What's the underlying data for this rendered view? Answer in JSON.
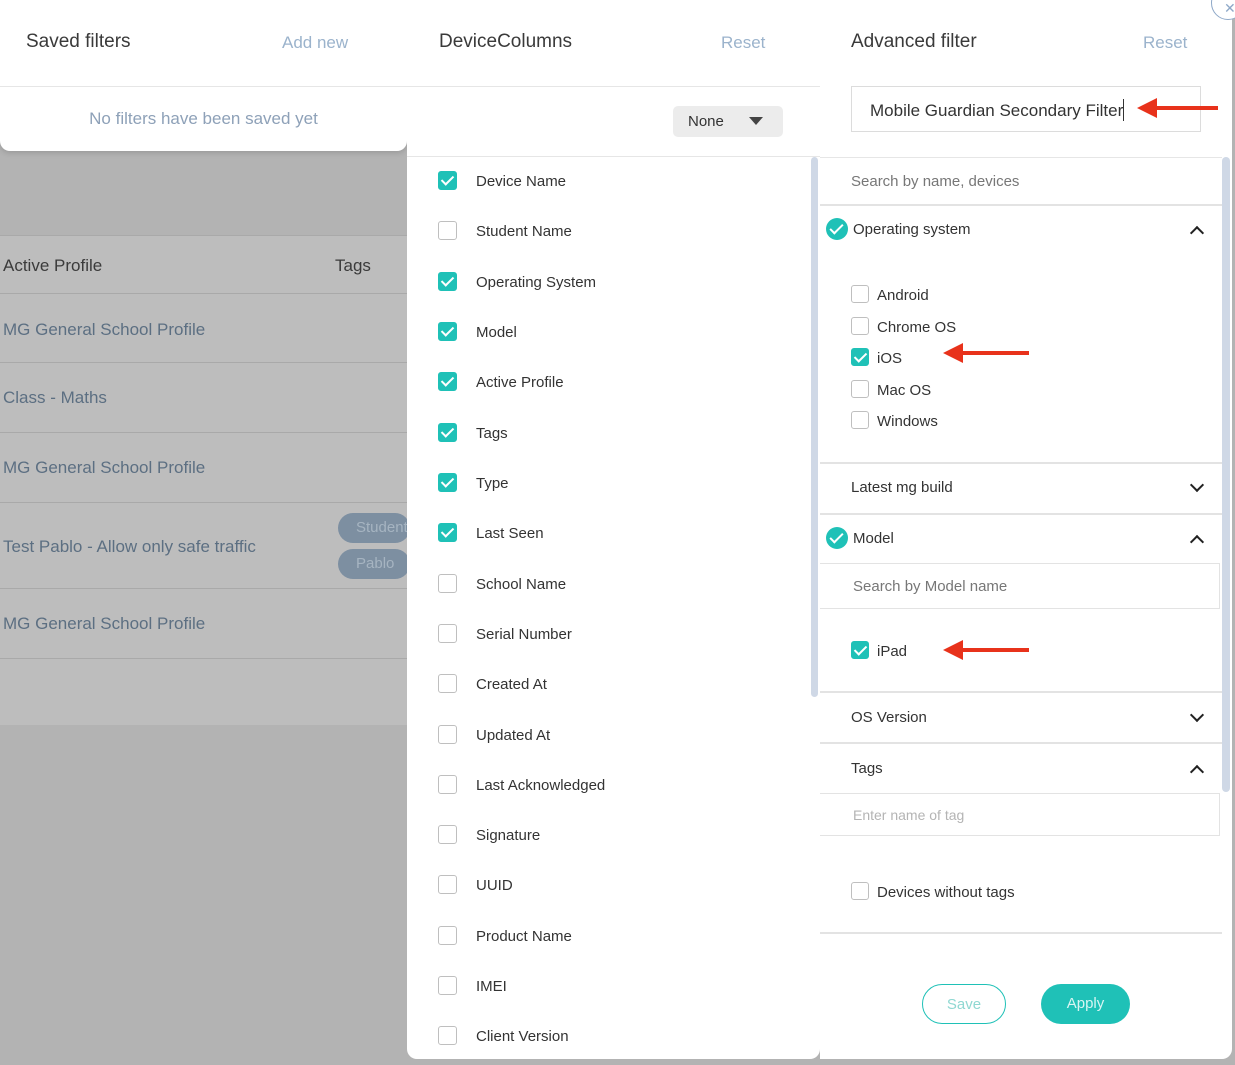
{
  "background_table": {
    "headers": [
      "Active Profile",
      "Tags"
    ],
    "rows": [
      {
        "profile": "MG General School Profile",
        "tags": []
      },
      {
        "profile": "Class - Maths",
        "tags": []
      },
      {
        "profile": "MG General School Profile",
        "tags": []
      },
      {
        "profile": "Test Pablo - Allow only safe traffic",
        "tags": [
          "Student",
          "Pablo"
        ]
      },
      {
        "profile": "MG General School Profile",
        "tags": []
      }
    ]
  },
  "saved_filters": {
    "title": "Saved filters",
    "add_new": "Add new",
    "empty_message": "No filters have been saved yet"
  },
  "device_columns": {
    "title": "DeviceColumns",
    "reset": "Reset",
    "preset_select": "None",
    "columns": [
      {
        "label": "Device Name",
        "checked": true
      },
      {
        "label": "Student Name",
        "checked": false
      },
      {
        "label": "Operating System",
        "checked": true
      },
      {
        "label": "Model",
        "checked": true
      },
      {
        "label": "Active Profile",
        "checked": true
      },
      {
        "label": "Tags",
        "checked": true
      },
      {
        "label": "Type",
        "checked": true
      },
      {
        "label": "Last Seen",
        "checked": true
      },
      {
        "label": "School Name",
        "checked": false
      },
      {
        "label": "Serial Number",
        "checked": false
      },
      {
        "label": "Created At",
        "checked": false
      },
      {
        "label": "Updated At",
        "checked": false
      },
      {
        "label": "Last Acknowledged",
        "checked": false
      },
      {
        "label": "Signature",
        "checked": false
      },
      {
        "label": "UUID",
        "checked": false
      },
      {
        "label": "Product Name",
        "checked": false
      },
      {
        "label": "IMEI",
        "checked": false
      },
      {
        "label": "Client Version",
        "checked": false
      }
    ]
  },
  "advanced_filter": {
    "title": "Advanced filter",
    "reset": "Reset",
    "filter_name_value": "Mobile Guardian Secondary Filter",
    "search_placeholder": "Search by name, devices",
    "operating_system": {
      "title": "Operating system",
      "options": [
        {
          "label": "Android",
          "checked": false
        },
        {
          "label": "Chrome OS",
          "checked": false
        },
        {
          "label": "iOS",
          "checked": true
        },
        {
          "label": "Mac OS",
          "checked": false
        },
        {
          "label": "Windows",
          "checked": false
        }
      ]
    },
    "latest_mg_build": {
      "title": "Latest mg build"
    },
    "model": {
      "title": "Model",
      "search_placeholder": "Search by Model name",
      "options": [
        {
          "label": "iPad",
          "checked": true
        }
      ]
    },
    "os_version": {
      "title": "OS Version"
    },
    "tags": {
      "title": "Tags",
      "input_placeholder": "Enter name of tag",
      "without_tags_label": "Devices without tags",
      "without_tags_checked": false
    },
    "save_label": "Save",
    "apply_label": "Apply"
  },
  "colors": {
    "accent": "#1fc1b7",
    "annotation": "#e8321b",
    "link": "#9bb3cc"
  }
}
